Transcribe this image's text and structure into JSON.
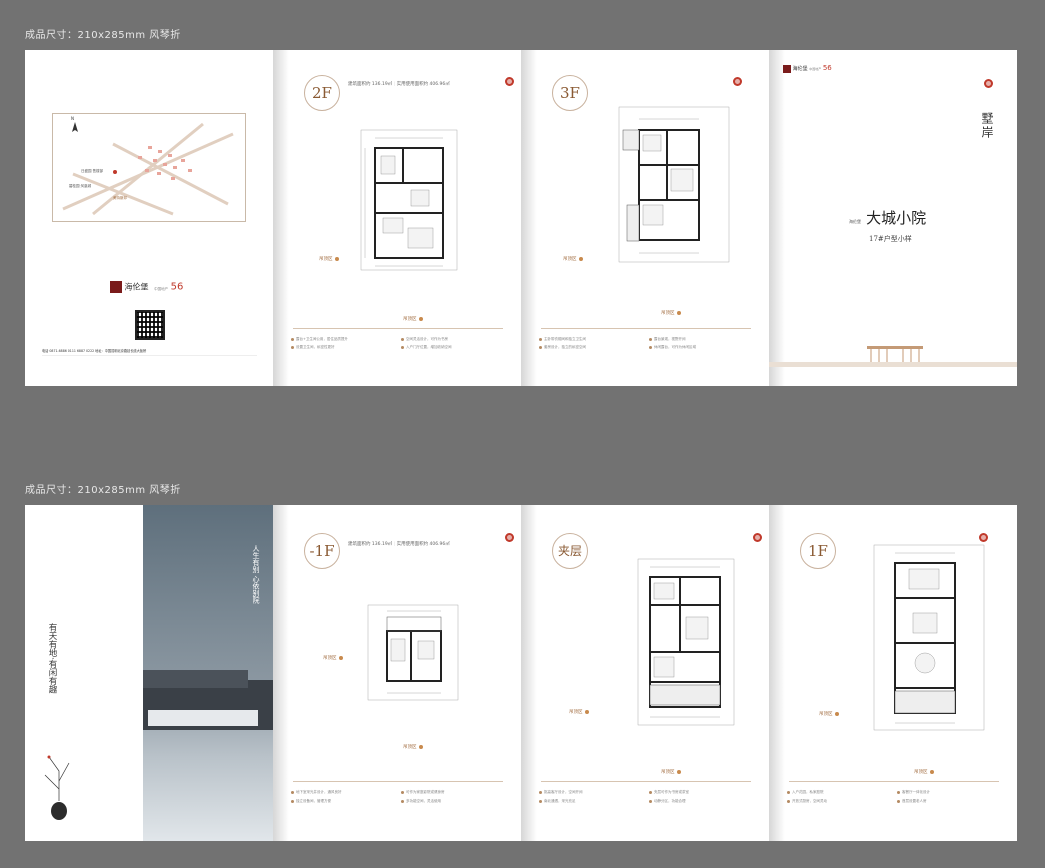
{
  "captions": [
    "成品尺寸：210x285mm  风琴折",
    "成品尺寸：210x285mm  风琴折"
  ],
  "colors": {
    "accent": "#a06a3d",
    "seal": "#c0392b",
    "background": "#727272",
    "logo": "#7a1b1b"
  },
  "top_spread": {
    "cover_back": {
      "map_labels": [
        "N",
        "日盛园 售楼部",
        "碧桂园·凤凰城",
        "美特斯邦"
      ],
      "brand_name": "海伦堡",
      "brand_tag": "中国地产",
      "brand_number": "56",
      "contact_line": "电话 0871-6886 0111  6887 0222   地址：中国昆明北京路延长线大板桥",
      "qr_name": "qr-code"
    },
    "floor_2f": {
      "badge": "2F",
      "stats_left": "建筑面积约 136.19㎡",
      "stats_right": "实用使用面积约 406.96㎡",
      "tag_a": "吊顶区",
      "tag_b": "吊顶区",
      "notes": [
        "露台+卫生间公用，居住品质提升",
        "空间灵活设计，可作为书房",
        "设置卫生间，私密性更好",
        "入户门厅位置，增加收纳空间"
      ]
    },
    "floor_3f": {
      "badge": "3F",
      "tag_a": "吊顶区",
      "tag_b": "吊顶区",
      "notes": [
        "主卧带衣帽间和独立卫生间",
        "露台景观，视野开阔",
        "套房设计，独立的私密空间",
        "休闲露台，可作为休闲区域"
      ]
    },
    "front_cover": {
      "brand_name": "海伦堡",
      "brand_tag": "中国地产",
      "brand_number": "56",
      "vertical_title": "墅岸",
      "project_prefix": "海伦堡",
      "project_name": "大城小院",
      "project_subtitle": "17#户型小样"
    }
  },
  "bottom_spread": {
    "intro": {
      "poem_left": "有天有地·有闲有趣",
      "poem_right": "人生有别 心依别院"
    },
    "floor_b1": {
      "badge": "-1F",
      "stats_left": "建筑面积约 136.19㎡",
      "stats_right": "实用使用面积约 406.96㎡",
      "tag_a": "吊顶区",
      "tag_b": "吊顶区",
      "notes": [
        "地下室采光井设计，通风良好",
        "可作为家庭影院或健身房",
        "独立设备间，管理方便",
        "多功能空间，灵活使用"
      ]
    },
    "floor_mezz": {
      "badge": "夹层",
      "tag_a": "吊顶区",
      "tag_b": "吊顶区",
      "notes": [
        "挑高客厅设计，空间开阔",
        "夹层可作为书房或茶室",
        "南北通透，采光充足",
        "动静分区，功能合理"
      ]
    },
    "floor_1f": {
      "badge": "1F",
      "tag_a": "吊顶区",
      "tag_b": "吊顶区",
      "notes": [
        "入户花园，私家庭院",
        "客餐厅一体化设计",
        "开放式厨房，空间灵动",
        "首层设置老人房"
      ]
    }
  },
  "icons": [
    "north-arrow-icon",
    "location-pin-icon",
    "seal-icon",
    "dot-icon"
  ]
}
